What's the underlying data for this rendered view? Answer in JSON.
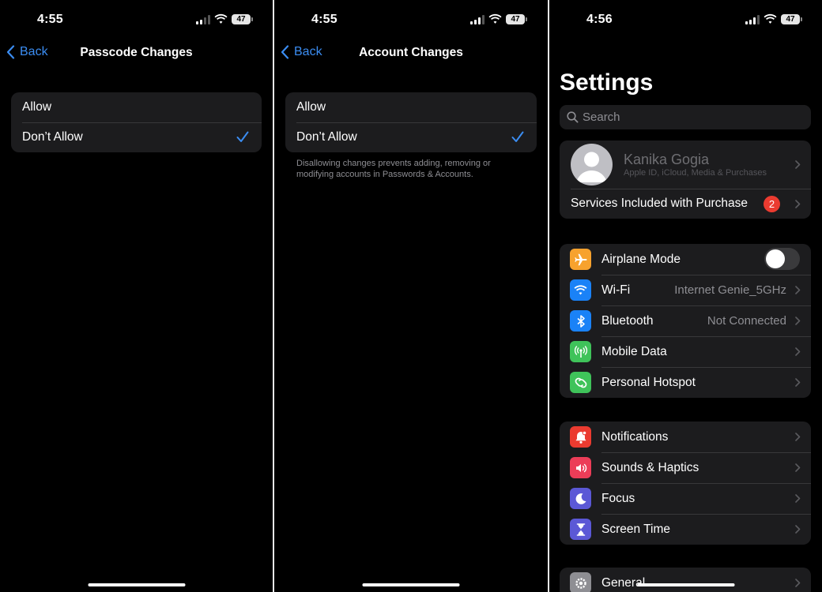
{
  "colors": {
    "accent": "#3b8df2",
    "group_bg": "#1c1c1e",
    "badge": "#eb3b30"
  },
  "panel1": {
    "time": "4:55",
    "battery": "47",
    "back_label": "Back",
    "title": "Passcode Changes",
    "options": [
      {
        "label": "Allow",
        "selected": false
      },
      {
        "label": "Don’t Allow",
        "selected": true
      }
    ]
  },
  "panel2": {
    "time": "4:55",
    "battery": "47",
    "back_label": "Back",
    "title": "Account Changes",
    "options": [
      {
        "label": "Allow",
        "selected": false
      },
      {
        "label": "Don’t Allow",
        "selected": true
      }
    ],
    "footnote": "Disallowing changes prevents adding, removing or modifying accounts in Passwords & Accounts."
  },
  "panel3": {
    "time": "4:56",
    "battery": "47",
    "title": "Settings",
    "search_placeholder": "Search",
    "profile": {
      "name": "Kanika Gogia",
      "subtitle": "Apple ID, iCloud, Media & Purchases"
    },
    "services": {
      "label": "Services Included with Purchase",
      "badge": "2"
    },
    "connectivity": [
      {
        "label": "Airplane Mode",
        "icon": "airplane-icon",
        "color": "#f7a22e",
        "toggle": false
      },
      {
        "label": "Wi-Fi",
        "icon": "wifi-icon",
        "color": "#1a82f7",
        "value": "Internet Genie_5GHz"
      },
      {
        "label": "Bluetooth",
        "icon": "bluetooth-icon",
        "color": "#1a82f7",
        "value": "Not Connected"
      },
      {
        "label": "Mobile Data",
        "icon": "antenna-icon",
        "color": "#3fc35a",
        "value": ""
      },
      {
        "label": "Personal Hotspot",
        "icon": "hotspot-icon",
        "color": "#3fc35a",
        "value": ""
      }
    ],
    "alerts": [
      {
        "label": "Notifications",
        "icon": "bell-icon",
        "color": "#eb3b30"
      },
      {
        "label": "Sounds & Haptics",
        "icon": "speaker-icon",
        "color": "#ec3d58"
      },
      {
        "label": "Focus",
        "icon": "moon-icon",
        "color": "#5b58d6"
      },
      {
        "label": "Screen Time",
        "icon": "hourglass-icon",
        "color": "#5b58d6"
      }
    ],
    "general": {
      "label": "General",
      "icon": "gear-icon",
      "color": "#8e8e93"
    }
  }
}
